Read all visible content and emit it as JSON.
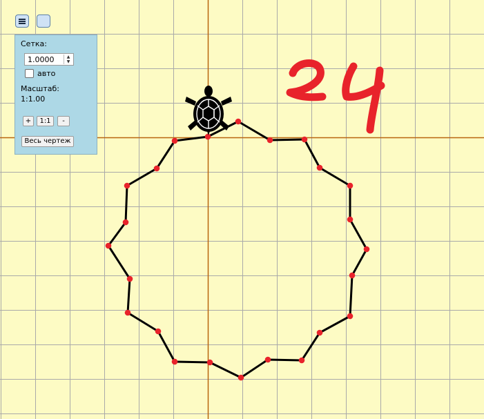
{
  "panel": {
    "grid_label": "Сетка:",
    "grid_value": "1.0000",
    "auto_label": "авто",
    "scale_label": "Масштаб:",
    "scale_value": "1:1.00",
    "zoom_in": "+",
    "zoom_reset": "1:1",
    "zoom_out": "-",
    "fit_all": "Весь чертеж"
  },
  "annotation": {
    "text": "24",
    "color": "#e8232b"
  },
  "colors": {
    "background": "#fdfbc4",
    "grid": "#a9a9a9",
    "axes": "#b8650f",
    "path": "#000000",
    "vertex": "#e8232b",
    "panel": "#add8e6"
  },
  "icons": {
    "menu": "menu-icon",
    "square": "square-icon",
    "turtle": "turtle-icon"
  }
}
